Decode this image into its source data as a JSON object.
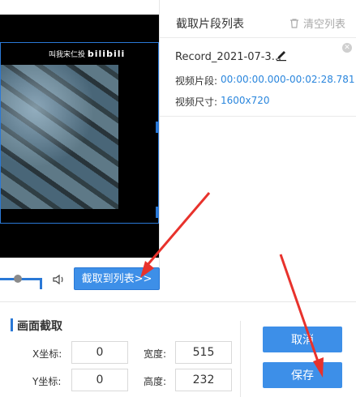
{
  "watermark": {
    "text": "叫我宋仁投",
    "brand": "bilibili"
  },
  "clip_list": {
    "title": "截取片段列表",
    "clear_label": "清空列表",
    "items": [
      {
        "name": "Record_2021-07-3...",
        "segment_label": "视频片段:",
        "segment_value": "00:00:00.000-00:02:28.781",
        "size_label": "视频尺寸:",
        "size_value": "1600x720"
      }
    ]
  },
  "controls": {
    "capture_button": "截取到列表>>",
    "progress": 0.2
  },
  "crop": {
    "title": "画面截取",
    "x_label": "X坐标:",
    "x_value": "0",
    "y_label": "Y坐标:",
    "y_value": "0",
    "width_label": "宽度:",
    "width_value": "515",
    "height_label": "高度:",
    "height_value": "232"
  },
  "actions": {
    "cancel": "取消",
    "save": "保存"
  },
  "colors": {
    "accent": "#3d8fe8",
    "link_value": "#2a86dd",
    "arrow": "#e8322c"
  }
}
